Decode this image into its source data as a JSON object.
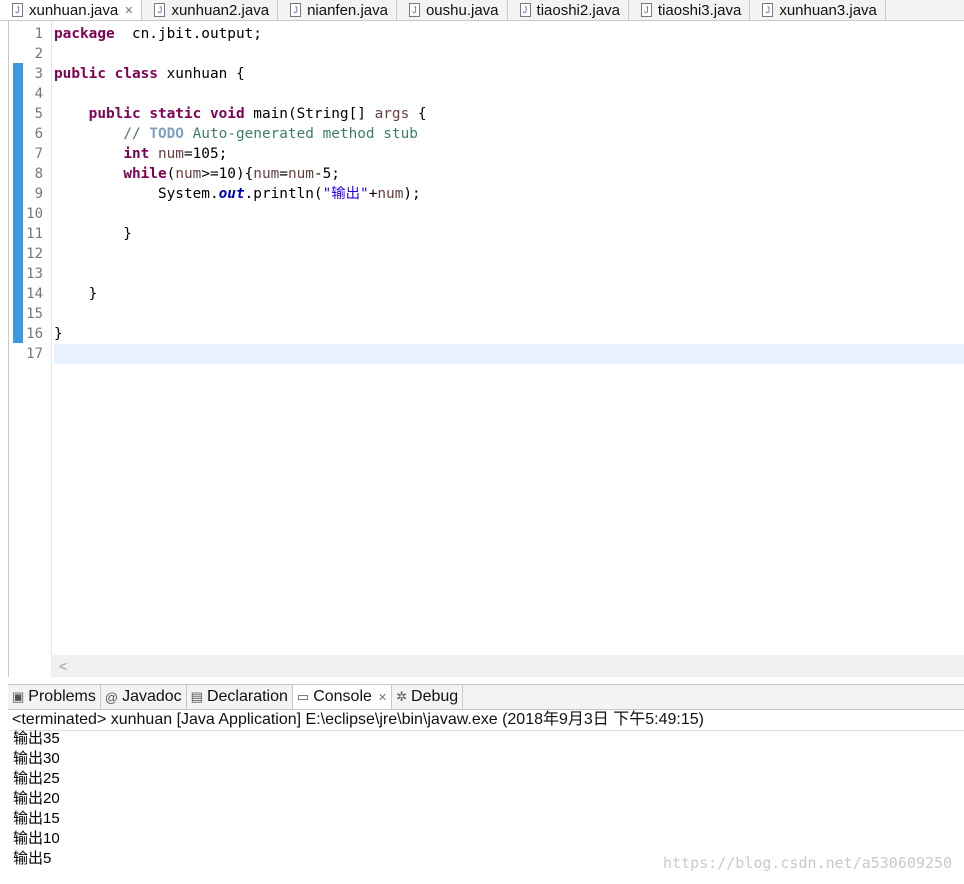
{
  "editor_tabs": [
    {
      "label": "xunhuan.java",
      "active": true,
      "closable": true
    },
    {
      "label": "xunhuan2.java"
    },
    {
      "label": "nianfen.java"
    },
    {
      "label": "oushu.java"
    },
    {
      "label": "tiaoshi2.java"
    },
    {
      "label": "tiaoshi3.java"
    },
    {
      "label": "xunhuan3.java"
    }
  ],
  "code_lines": [
    [
      [
        "kw",
        "package"
      ],
      [
        "",
        "  cn.jbit.output;"
      ]
    ],
    [],
    [
      [
        "kw",
        "public"
      ],
      [
        "",
        " "
      ],
      [
        "kw",
        "class"
      ],
      [
        "",
        " xunhuan {"
      ]
    ],
    [],
    [
      [
        "",
        "    "
      ],
      [
        "kw",
        "public"
      ],
      [
        "",
        " "
      ],
      [
        "kw",
        "static"
      ],
      [
        "",
        " "
      ],
      [
        "kw",
        "void"
      ],
      [
        "",
        " main(String[] "
      ],
      [
        "var",
        "args"
      ],
      [
        "",
        " {"
      ]
    ],
    [
      [
        "",
        "        "
      ],
      [
        "cm",
        "// "
      ],
      [
        "todo",
        "TODO"
      ],
      [
        "cm",
        " Auto-generated method stub"
      ]
    ],
    [
      [
        "",
        "        "
      ],
      [
        "kw",
        "int"
      ],
      [
        "",
        " "
      ],
      [
        "var",
        "num"
      ],
      [
        "",
        "=105;"
      ]
    ],
    [
      [
        "",
        "        "
      ],
      [
        "kw",
        "while"
      ],
      [
        "",
        "("
      ],
      [
        "var",
        "num"
      ],
      [
        "",
        ">=10){"
      ],
      [
        "var",
        "num"
      ],
      [
        "",
        "="
      ],
      [
        "var",
        "num"
      ],
      [
        "",
        "-5;"
      ]
    ],
    [
      [
        "",
        "            System."
      ],
      [
        "fld",
        "out"
      ],
      [
        "",
        ".println("
      ],
      [
        "str",
        "\"输出\""
      ],
      [
        "",
        "+"
      ],
      [
        "var",
        "num"
      ],
      [
        "",
        ");"
      ]
    ],
    [],
    [
      [
        "",
        "        }"
      ]
    ],
    [],
    [],
    [
      [
        "",
        "    }"
      ]
    ],
    [],
    [
      [
        "",
        "}"
      ]
    ],
    []
  ],
  "hscroll_arrow": "<",
  "panel_tabs": [
    {
      "label": "Problems",
      "icon": "problems-icon"
    },
    {
      "label": "Javadoc",
      "icon": "at-icon"
    },
    {
      "label": "Declaration",
      "icon": "declaration-icon"
    },
    {
      "label": "Console",
      "icon": "console-icon",
      "active": true,
      "closable": true
    },
    {
      "label": "Debug",
      "icon": "bug-icon"
    }
  ],
  "console": {
    "status": "<terminated> xunhuan [Java Application] E:\\eclipse\\jre\\bin\\javaw.exe (2018年9月3日 下午5:49:15)",
    "output": [
      "输出35",
      "输出30",
      "输出25",
      "输出20",
      "输出15",
      "输出10",
      "输出5"
    ]
  },
  "watermark": "https://blog.csdn.net/a530609250"
}
